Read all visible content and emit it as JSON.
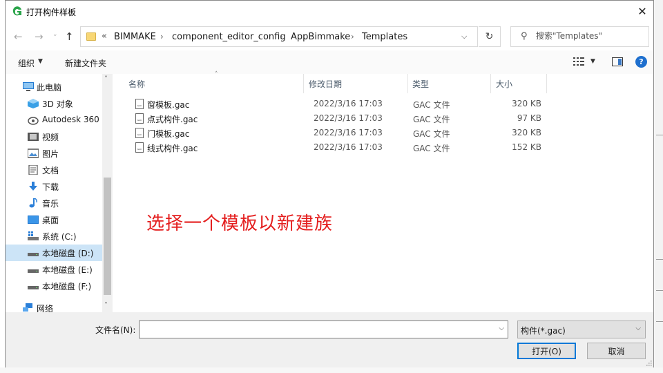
{
  "window": {
    "title": "打开构件样板",
    "close_glyph": "✕"
  },
  "nav": {
    "back_glyph": "←",
    "forward_glyph": "→",
    "recent_glyph": "⌄",
    "up_glyph": "↑",
    "chevrons": "«",
    "breadcrumbs": [
      "BIMMAKE",
      "component_editor_config",
      "AppBimmake",
      "Templates"
    ],
    "separator": "›",
    "dropdown_glyph": "⌵",
    "refresh_glyph": "↻",
    "search_placeholder": "搜索\"Templates\"",
    "search_glyph": "⚲"
  },
  "toolbar": {
    "organize_label": "组织",
    "caret": "▼",
    "new_folder_label": "新建文件夹",
    "help_glyph": "?"
  },
  "sidebar": {
    "items": [
      {
        "label": "此电脑",
        "icon": "computer-icon"
      },
      {
        "label": "3D 对象",
        "icon": "3d-objects-icon"
      },
      {
        "label": "Autodesk 360",
        "icon": "autodesk-cloud-icon"
      },
      {
        "label": "视频",
        "icon": "videos-icon"
      },
      {
        "label": "图片",
        "icon": "pictures-icon"
      },
      {
        "label": "文档",
        "icon": "documents-icon"
      },
      {
        "label": "下载",
        "icon": "downloads-icon"
      },
      {
        "label": "音乐",
        "icon": "music-icon"
      },
      {
        "label": "桌面",
        "icon": "desktop-icon"
      },
      {
        "label": "系统 (C:)",
        "icon": "system-drive-icon"
      },
      {
        "label": "本地磁盘 (D:)",
        "icon": "drive-icon"
      },
      {
        "label": "本地磁盘 (E:)",
        "icon": "drive-icon"
      },
      {
        "label": "本地磁盘 (F:)",
        "icon": "drive-icon"
      },
      {
        "label": "网络",
        "icon": "network-icon"
      }
    ],
    "selected_index": 10,
    "scroll_up": "˄",
    "scroll_down": "˅"
  },
  "filelist": {
    "columns": {
      "name": "名称",
      "date": "修改日期",
      "type": "类型",
      "size": "大小"
    },
    "sort_glyph": "˄",
    "files": [
      {
        "name": "窗模板.gac",
        "date": "2022/3/16 17:03",
        "type": "GAC 文件",
        "size": "320 KB"
      },
      {
        "name": "点式构件.gac",
        "date": "2022/3/16 17:03",
        "type": "GAC 文件",
        "size": "97 KB"
      },
      {
        "name": "门模板.gac",
        "date": "2022/3/16 17:03",
        "type": "GAC 文件",
        "size": "320 KB"
      },
      {
        "name": "线式构件.gac",
        "date": "2022/3/16 17:03",
        "type": "GAC 文件",
        "size": "152 KB"
      }
    ],
    "annotation": "选择一个模板以新建族"
  },
  "bottom": {
    "filename_label": "文件名(N):",
    "filename_value": "",
    "dropdown_glyph": "⌵",
    "filetype_value": "构件(*.gac)",
    "open_label": "打开(O)",
    "cancel_label": "取消"
  }
}
